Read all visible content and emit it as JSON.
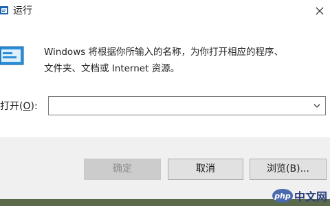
{
  "window": {
    "title": "运行",
    "close_glyph": "✕",
    "app_icon": "run-dialog-icon"
  },
  "description": {
    "line1": "Windows 将根据你所输入的名称，为你打开相应的程序、",
    "line2": "文件夹、文档或 Internet 资源。"
  },
  "open": {
    "label_prefix": "打开(",
    "label_key": "O",
    "label_suffix": "):",
    "value": "",
    "dropdown_icon": "chevron-down-icon"
  },
  "buttons": {
    "ok": "确定",
    "cancel": "取消",
    "browse": "浏览(B)..."
  },
  "watermark": {
    "badge": "php",
    "text": "中文网"
  },
  "colors": {
    "accent": "#1e64b4",
    "footer_bg": "#f0f0f0",
    "button_bg": "#e1e1e1",
    "disabled_text": "#8c8c8c"
  }
}
